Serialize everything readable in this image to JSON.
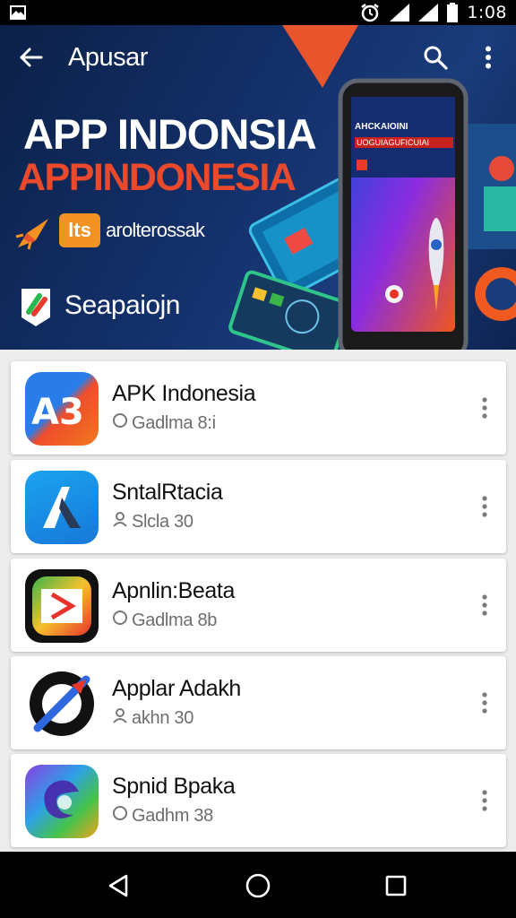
{
  "status_bar": {
    "time": "1:08",
    "icons": [
      "gallery-icon",
      "alarm-icon",
      "signal-icon",
      "signal-icon",
      "battery-icon"
    ]
  },
  "app_bar": {
    "title": "Apusar",
    "icons": [
      "back-arrow-icon",
      "search-icon",
      "more-vert-icon"
    ]
  },
  "hero": {
    "title": "APP INDONSIA",
    "subtitle": "APPINDONESIA",
    "badge": "lts",
    "tagline": "arolterossak",
    "cta": "Seapaiojn",
    "phone_screen_title": "AHCKAIOINI",
    "phone_screen_subtitle": "UOGUIAGUFICUIAI",
    "colors": {
      "background": "#13306a",
      "subtitle": "#ea4a2b",
      "accent": "#f29225"
    }
  },
  "apps": [
    {
      "name": "APK Indonesia",
      "meta": "Gadlma 8:i",
      "icon": "a3-logo-icon",
      "meta_icon": "info-circle-icon"
    },
    {
      "name": "SntalRtacia",
      "meta": "Slcla 30",
      "icon": "a-triangle-logo-icon",
      "meta_icon": "person-icon"
    },
    {
      "name": "Apnlin:Beata",
      "meta": "Gadlma 8b",
      "icon": "play-box-logo-icon",
      "meta_icon": "info-circle-icon"
    },
    {
      "name": "Applar Adakh",
      "meta": "akhn 30",
      "icon": "slash-logo-icon",
      "meta_icon": "person-icon"
    },
    {
      "name": "Spnid Bpaka",
      "meta": "Gadhm 38",
      "icon": "swirl-logo-icon",
      "meta_icon": "info-circle-icon"
    }
  ],
  "nav_bar": {
    "buttons": [
      "back-icon",
      "home-icon",
      "recents-icon"
    ]
  }
}
